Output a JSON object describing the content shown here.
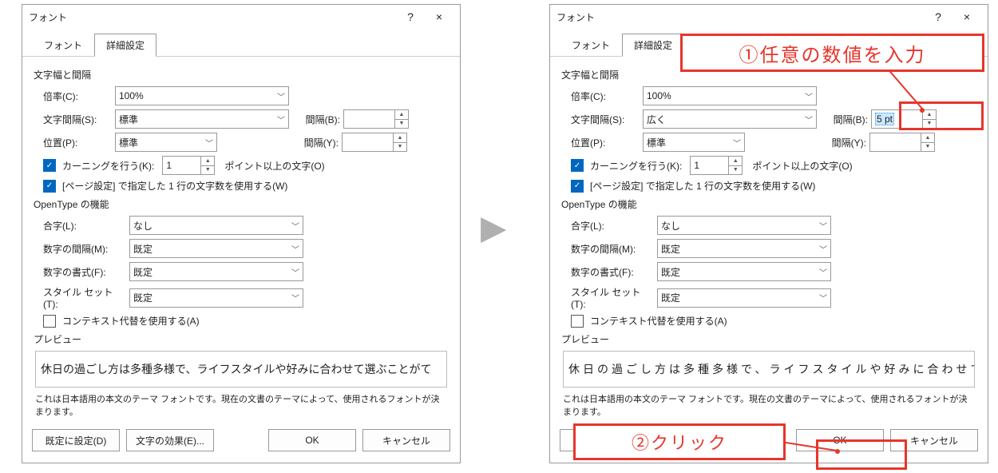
{
  "dialog_title": "フォント",
  "help_symbol": "?",
  "close_symbol": "×",
  "tabs": {
    "font": "フォント",
    "advanced": "詳細設定"
  },
  "width_spacing_label": "文字幅と間隔",
  "scale_label": "倍率(C):",
  "scale_value": "100%",
  "spacing_label": "文字間隔(S):",
  "spacing_value_left": "標準",
  "spacing_value_right": "広く",
  "position_label": "位置(P):",
  "position_value": "標準",
  "interval_b": "間隔(B):",
  "interval_y": "間隔(Y):",
  "interval_b_value_left": "",
  "interval_b_value_right": "5 pt",
  "kerning_label": "カーニングを行う(K):",
  "kerning_value": "1",
  "kerning_suffix": "ポイント以上の文字(O)",
  "pagegrid_label": "[ページ設定] で指定した 1 行の文字数を使用する(W)",
  "opentype_label": "OpenType の機能",
  "ligature_label": "合字(L):",
  "ligature_value": "なし",
  "numspace_label": "数字の間隔(M):",
  "numspace_value": "既定",
  "numform_label": "数字の書式(F):",
  "numform_value": "既定",
  "styleset_label": "スタイル セット(T):",
  "styleset_value": "既定",
  "context_label": "コンテキスト代替を使用する(A)",
  "preview_label": "プレビュー",
  "preview_text_left": "休日の過ごし方は多種多様で、ライフスタイルや好みに合わせて選ぶことがて",
  "preview_text_right": "休日の過ごし方は多種多様で、ライフスタイルや好みに合わせて選ぶことがて",
  "help_text": "これは日本語用の本文のテーマ フォントです。現在の文書のテーマによって、使用されるフォントが決まります。",
  "btn_default": "既定に設定(D)",
  "btn_effects": "文字の効果(E)...",
  "btn_ok": "OK",
  "btn_cancel": "キャンセル",
  "ann1": "①任意の数値を入力",
  "ann2": "②クリック",
  "checkmark": "✓",
  "chev": "﹀",
  "uptri": "▲",
  "dntri": "▼"
}
